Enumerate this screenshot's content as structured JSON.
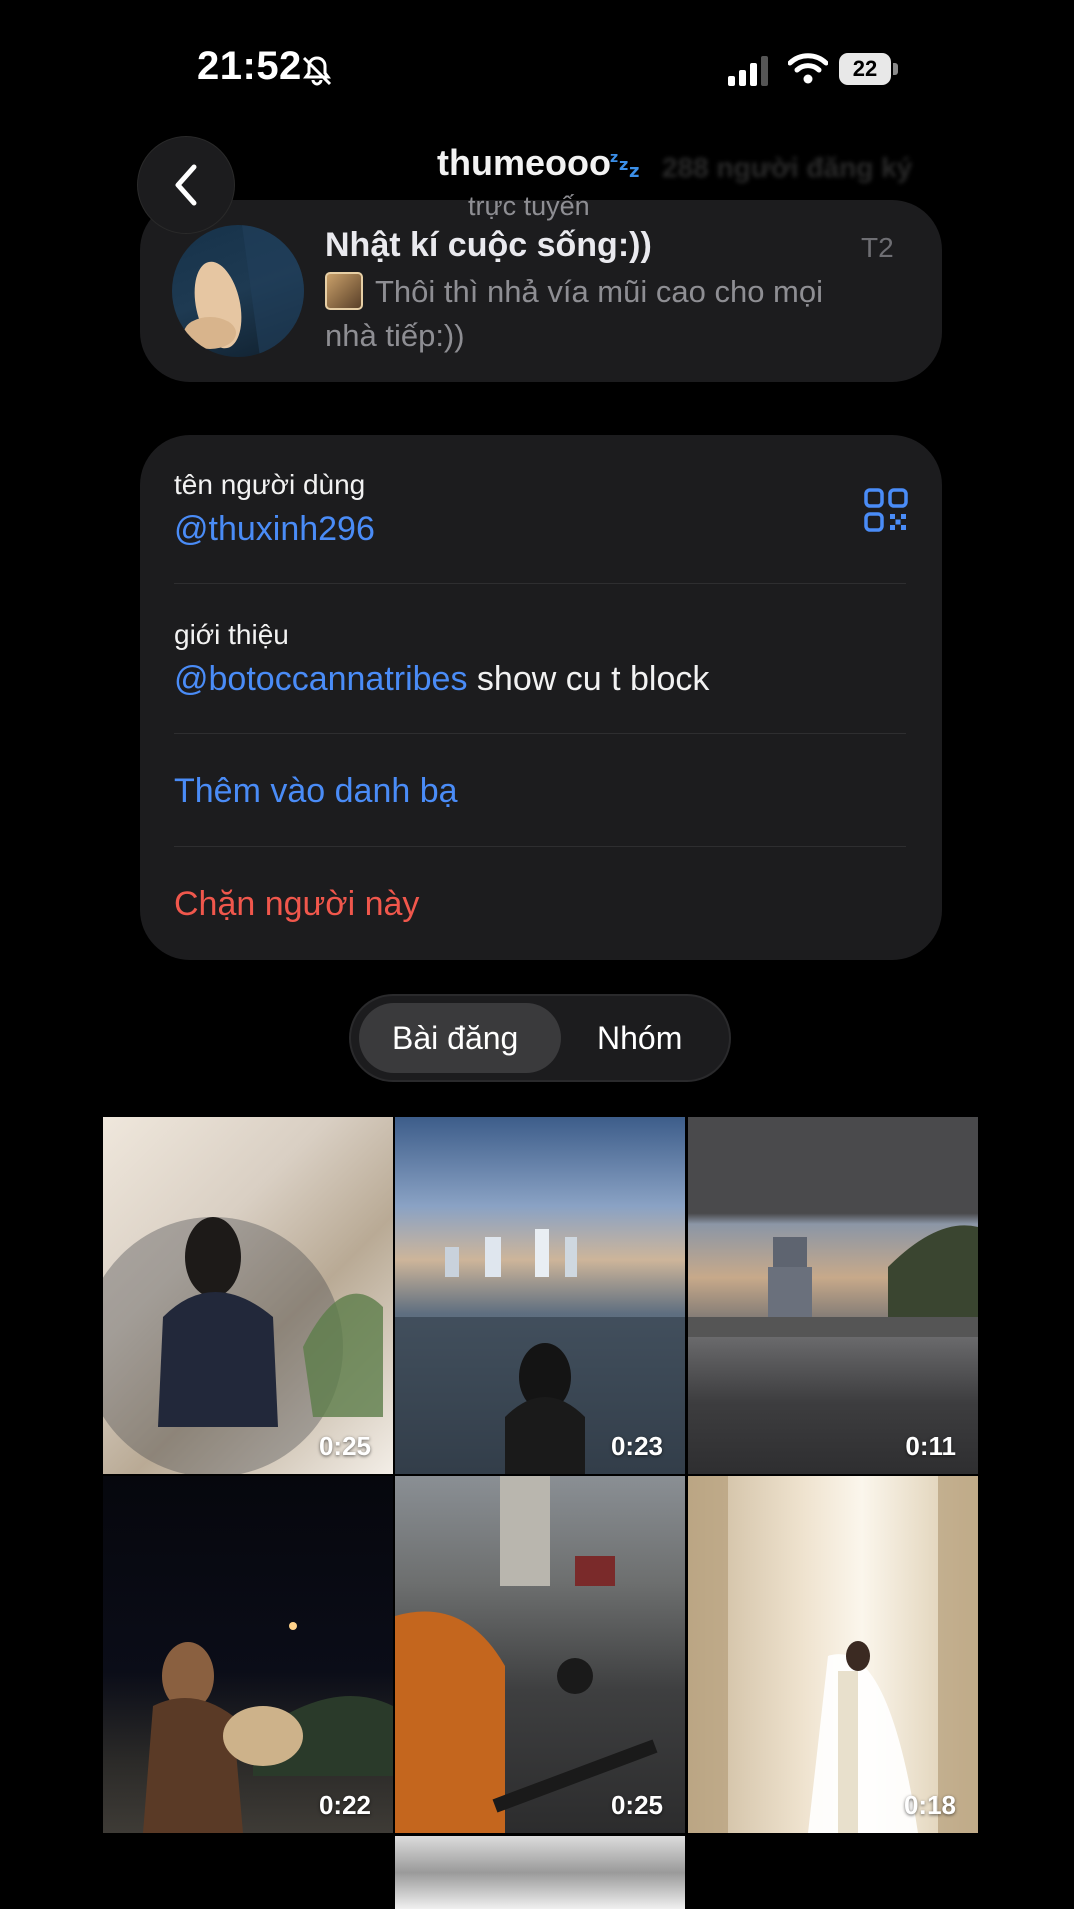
{
  "status_bar": {
    "time": "21:52",
    "battery": "22"
  },
  "header": {
    "title": "thumeooo",
    "status": "trực tuyến",
    "subscribers_hint": "288 người đăng ký"
  },
  "channel": {
    "name": "Nhật kí cuộc sống:))",
    "day": "T2",
    "message": "Thôi thì nhả vía mũi cao cho mọi nhà tiếp:))"
  },
  "info": {
    "username_label": "tên người dùng",
    "username": "@thuxinh296",
    "bio_label": "giới thiệu",
    "bio_mention": "@botoccannatribes",
    "bio_text": " show cu t block",
    "add_contact": "Thêm vào danh bạ",
    "block": "Chặn người này"
  },
  "tabs": {
    "posts": "Bài đăng",
    "groups": "Nhóm",
    "active": "posts"
  },
  "media": [
    {
      "duration": "0:25"
    },
    {
      "duration": "0:23"
    },
    {
      "duration": "0:11"
    },
    {
      "duration": "0:22"
    },
    {
      "duration": "0:25"
    },
    {
      "duration": "0:18"
    }
  ],
  "colors": {
    "accent_blue": "#4a8cf7",
    "danger_red": "#f0574c",
    "card_bg": "#1c1c1e"
  }
}
